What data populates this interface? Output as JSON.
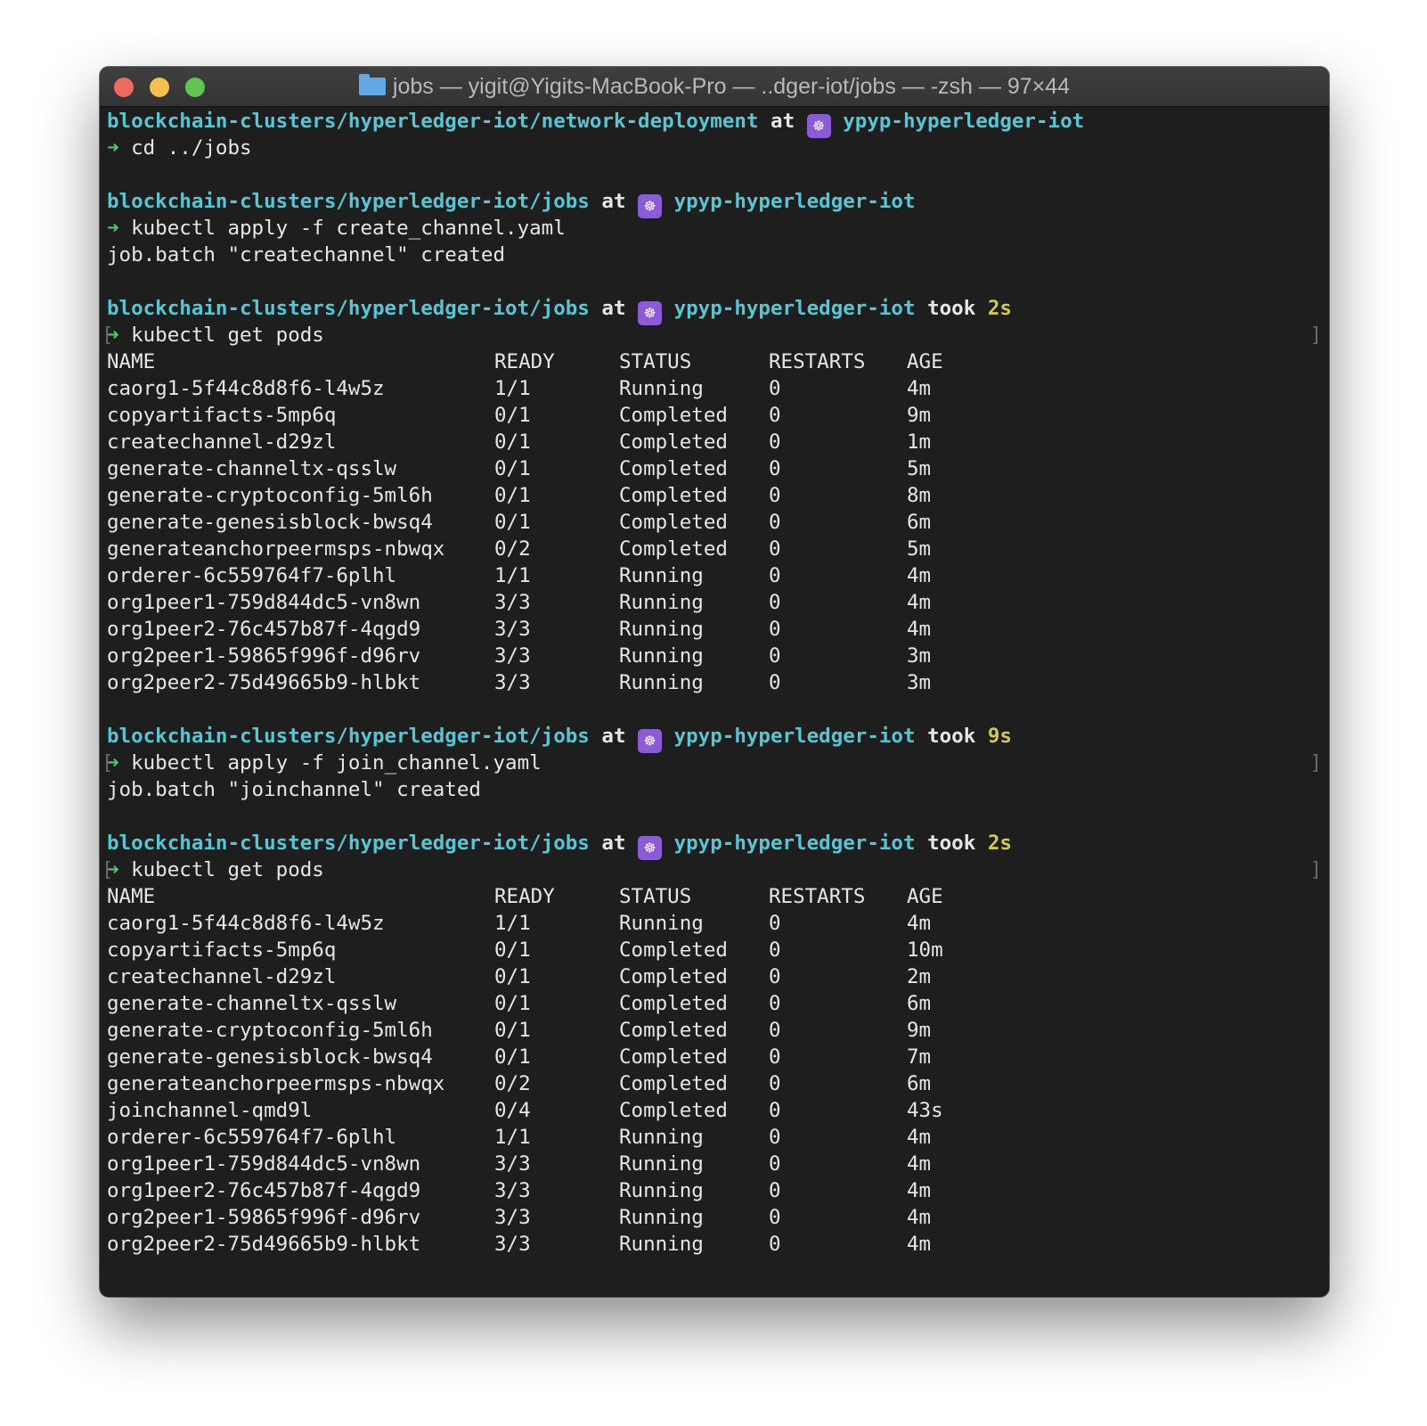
{
  "window": {
    "title": "jobs — yigit@Yigits-MacBook-Pro — ..dger-iot/jobs — -zsh — 97×44"
  },
  "prompt": {
    "at": "at",
    "context": "ypyp-hyperledger-iot",
    "took": "took",
    "arrow": "➜",
    "k8s_icon": "☸"
  },
  "blocks": [
    {
      "path": "blockchain-clusters/hyperledger-iot/network-deployment",
      "command": "cd ../jobs",
      "output": []
    },
    {
      "path": "blockchain-clusters/hyperledger-iot/jobs",
      "command": "kubectl apply -f create_channel.yaml",
      "output": [
        "job.batch \"createchannel\" created"
      ]
    },
    {
      "path": "blockchain-clusters/hyperledger-iot/jobs",
      "took": "2s",
      "command": "kubectl get pods",
      "table": {
        "headers": [
          "NAME",
          "READY",
          "STATUS",
          "RESTARTS",
          "AGE"
        ],
        "rows": [
          [
            "caorg1-5f44c8d8f6-l4w5z",
            "1/1",
            "Running",
            "0",
            "4m"
          ],
          [
            "copyartifacts-5mp6q",
            "0/1",
            "Completed",
            "0",
            "9m"
          ],
          [
            "createchannel-d29zl",
            "0/1",
            "Completed",
            "0",
            "1m"
          ],
          [
            "generate-channeltx-qsslw",
            "0/1",
            "Completed",
            "0",
            "5m"
          ],
          [
            "generate-cryptoconfig-5ml6h",
            "0/1",
            "Completed",
            "0",
            "8m"
          ],
          [
            "generate-genesisblock-bwsq4",
            "0/1",
            "Completed",
            "0",
            "6m"
          ],
          [
            "generateanchorpeermsps-nbwqx",
            "0/2",
            "Completed",
            "0",
            "5m"
          ],
          [
            "orderer-6c559764f7-6plhl",
            "1/1",
            "Running",
            "0",
            "4m"
          ],
          [
            "org1peer1-759d844dc5-vn8wn",
            "3/3",
            "Running",
            "0",
            "4m"
          ],
          [
            "org1peer2-76c457b87f-4qgd9",
            "3/3",
            "Running",
            "0",
            "4m"
          ],
          [
            "org2peer1-59865f996f-d96rv",
            "3/3",
            "Running",
            "0",
            "3m"
          ],
          [
            "org2peer2-75d49665b9-hlbkt",
            "3/3",
            "Running",
            "0",
            "3m"
          ]
        ]
      }
    },
    {
      "path": "blockchain-clusters/hyperledger-iot/jobs",
      "took": "9s",
      "command": "kubectl apply -f join_channel.yaml",
      "output": [
        "job.batch \"joinchannel\" created"
      ]
    },
    {
      "path": "blockchain-clusters/hyperledger-iot/jobs",
      "took": "2s",
      "command": "kubectl get pods",
      "table": {
        "headers": [
          "NAME",
          "READY",
          "STATUS",
          "RESTARTS",
          "AGE"
        ],
        "rows": [
          [
            "caorg1-5f44c8d8f6-l4w5z",
            "1/1",
            "Running",
            "0",
            "4m"
          ],
          [
            "copyartifacts-5mp6q",
            "0/1",
            "Completed",
            "0",
            "10m"
          ],
          [
            "createchannel-d29zl",
            "0/1",
            "Completed",
            "0",
            "2m"
          ],
          [
            "generate-channeltx-qsslw",
            "0/1",
            "Completed",
            "0",
            "6m"
          ],
          [
            "generate-cryptoconfig-5ml6h",
            "0/1",
            "Completed",
            "0",
            "9m"
          ],
          [
            "generate-genesisblock-bwsq4",
            "0/1",
            "Completed",
            "0",
            "7m"
          ],
          [
            "generateanchorpeermsps-nbwqx",
            "0/2",
            "Completed",
            "0",
            "6m"
          ],
          [
            "joinchannel-qmd9l",
            "0/4",
            "Completed",
            "0",
            "43s"
          ],
          [
            "orderer-6c559764f7-6plhl",
            "1/1",
            "Running",
            "0",
            "4m"
          ],
          [
            "org1peer1-759d844dc5-vn8wn",
            "3/3",
            "Running",
            "0",
            "4m"
          ],
          [
            "org1peer2-76c457b87f-4qgd9",
            "3/3",
            "Running",
            "0",
            "4m"
          ],
          [
            "org2peer1-59865f996f-d96rv",
            "3/3",
            "Running",
            "0",
            "4m"
          ],
          [
            "org2peer2-75d49665b9-hlbkt",
            "3/3",
            "Running",
            "0",
            "4m"
          ]
        ]
      }
    }
  ]
}
